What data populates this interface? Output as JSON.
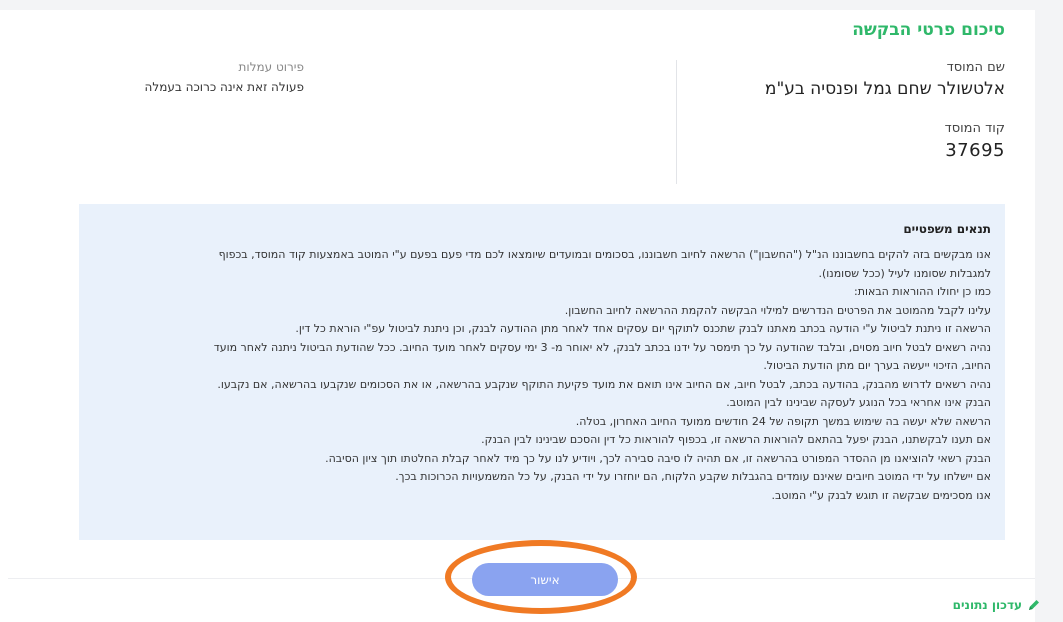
{
  "summary": {
    "title": "סיכום פרטי הבקשה",
    "institution_name_label": "שם המוסד",
    "institution_name": "אלטשולר שחם גמל ופנסיה בע\"מ",
    "institution_code_label": "קוד המוסד",
    "institution_code": "37695",
    "fees_label": "פירוט עמלות",
    "fees_value": "פעולה זאת אינה כרוכה בעמלה"
  },
  "terms": {
    "title": "תנאים משפטיים",
    "lines": [
      "אנו מבקשים בזה להקים בחשבוננו הנ\"ל (\"החשבון\") הרשאה לחיוב חשבוננו, בסכומים ובמועדים שיומצאו לכם מדי פעם בפעם ע\"י המוטב באמצעות קוד המוסד, בכפוף",
      "למגבלות שסומנו לעיל (ככל שסומנו).",
      "כמו כן יחולו ההוראות הבאות:",
      "עלינו לקבל מהמוטב את הפרטים הנדרשים למילוי הבקשה להקמת ההרשאה לחיוב החשבון.",
      "הרשאה זו ניתנת לביטול ע\"י הודעה בכתב מאתנו לבנק שתכנס לתוקף יום עסקים אחד לאחר מתן ההודעה לבנק, וכן ניתנת לביטול עפ\"י הוראת כל דין.",
      "נהיה רשאים לבטל חיוב מסוים, ובלבד שהודעה על כך תימסר על ידנו בכתב לבנק, לא יאוחר מ- 3 ימי עסקים לאחר מועד החיוב. ככל שהודעת הביטול ניתנה לאחר מועד",
      "החיוב, הזיכוי ייעשה בערך יום מתן הודעת הביטול.",
      "נהיה רשאים לדרוש מהבנק, בהודעה בכתב, לבטל חיוב, אם החיוב אינו תואם את מועד פקיעת התוקף שנקבע בהרשאה, או את הסכומים שנקבעו בהרשאה, אם נקבעו.",
      "הבנק אינו אחראי בכל הנוגע לעסקה שבינינו לבין המוטב.",
      "הרשאה שלא יעשה בה שימוש במשך תקופה של 24 חודשים ממועד החיוב האחרון, בטלה.",
      "אם תענו לבקשתנו, הבנק יפעל בהתאם להוראות הרשאה זו, בכפוף להוראות כל דין והסכם שבינינו לבין הבנק.",
      "הבנק רשאי להוציאנו מן ההסדר המפורט בהרשאה זו, אם תהיה לו סיבה סבירה לכך, ויודיע לנו על כך מיד לאחר קבלת החלטתו תוך ציון הסיבה.",
      "אם יישלחו על ידי המוטב חיובים שאינם עומדים בהגבלות שקבע הלקוח, הם יוחזרו על ידי הבנק, על כל המשמעויות הכרוכות בכך.",
      "אנו מסכימים שבקשה זו תוגש לבנק ע\"י המוטב."
    ]
  },
  "actions": {
    "confirm_label": "אישור",
    "update_label": "עדכון נתונים"
  },
  "icons": {
    "update": "pencil-icon"
  },
  "colors": {
    "accent_green": "#2fb86a",
    "button_blue": "#8aa3f0",
    "terms_background": "#e9f1fb",
    "highlight_orange": "#f07a24"
  }
}
